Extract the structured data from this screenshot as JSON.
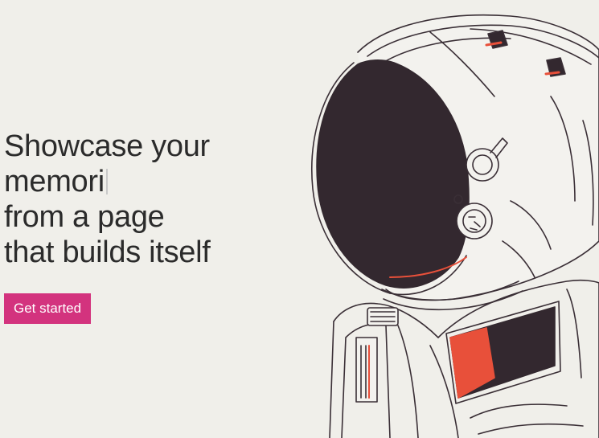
{
  "hero": {
    "line1": "Showcase your",
    "line2": "memori",
    "line3": "from a page",
    "line4": "that builds itself",
    "cta_label": "Get started"
  },
  "illustration": {
    "icon": "astronaut-illustration"
  },
  "colors": {
    "background": "#f0efea",
    "text": "#2b2b2b",
    "accent": "#d3337e",
    "visor": "#33282f",
    "patch_red": "#e8503a"
  }
}
